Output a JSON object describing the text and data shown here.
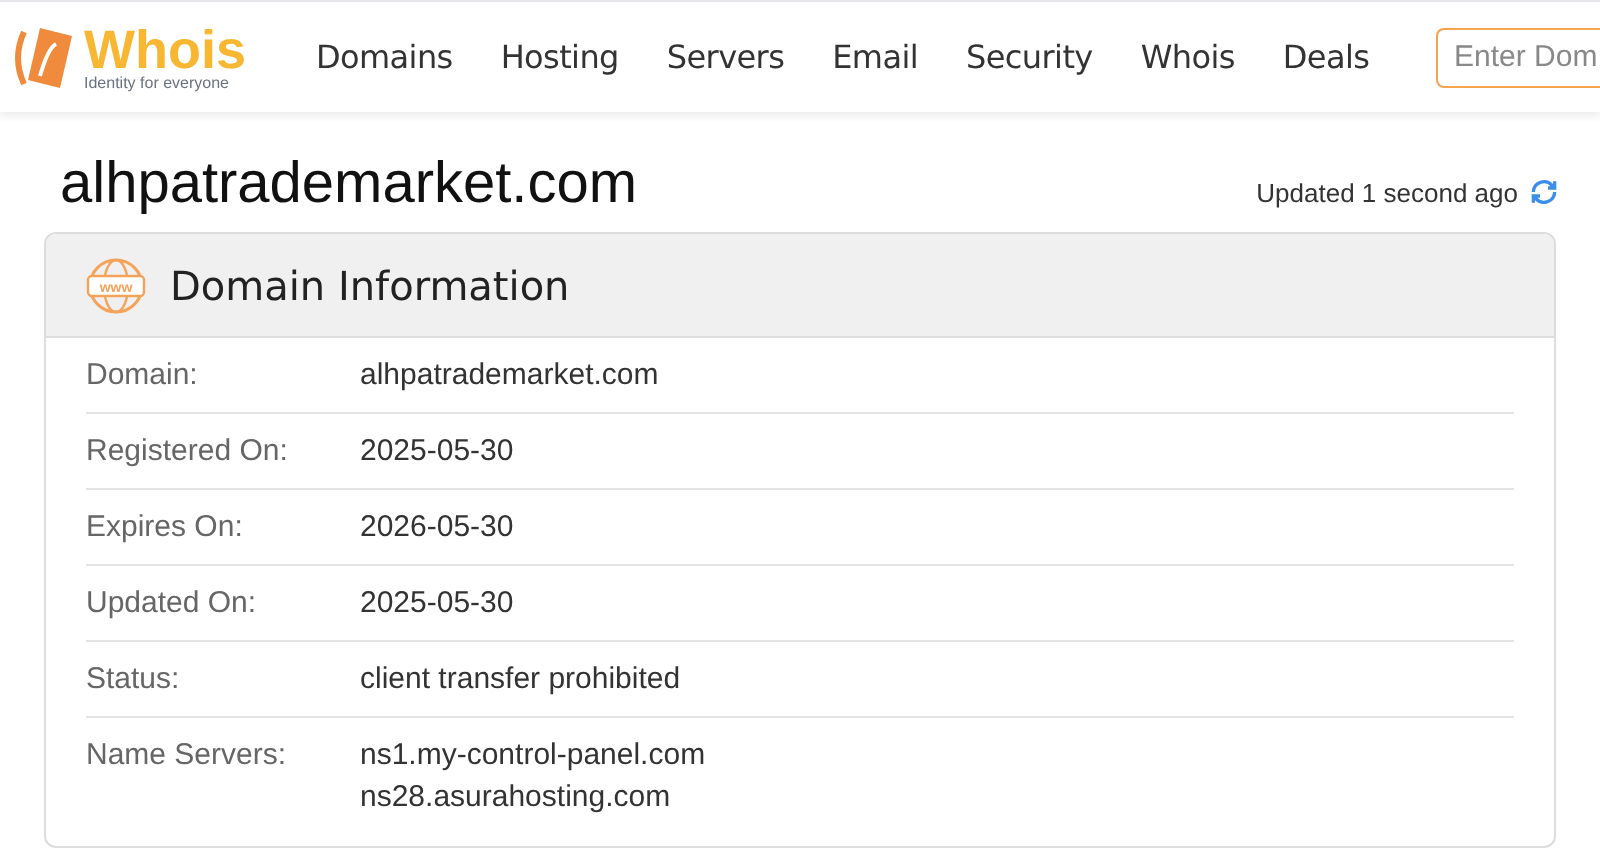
{
  "logo": {
    "name": "Whois",
    "tagline": "Identity for everyone"
  },
  "nav": [
    "Domains",
    "Hosting",
    "Servers",
    "Email",
    "Security",
    "Whois",
    "Deals"
  ],
  "search": {
    "placeholder": "Enter Dom"
  },
  "page_title": "alhpatrademarket.com",
  "updated": "Updated 1 second ago",
  "card": {
    "icon_text": "www",
    "title": "Domain Information",
    "rows": [
      {
        "label": "Domain:",
        "values": [
          "alhpatrademarket.com"
        ]
      },
      {
        "label": "Registered On:",
        "values": [
          "2025-05-30"
        ]
      },
      {
        "label": "Expires On:",
        "values": [
          "2026-05-30"
        ]
      },
      {
        "label": "Updated On:",
        "values": [
          "2025-05-30"
        ]
      },
      {
        "label": "Status:",
        "values": [
          "client transfer prohibited"
        ]
      },
      {
        "label": "Name Servers:",
        "values": [
          "ns1.my-control-panel.com",
          "ns28.asurahosting.com"
        ]
      }
    ]
  }
}
